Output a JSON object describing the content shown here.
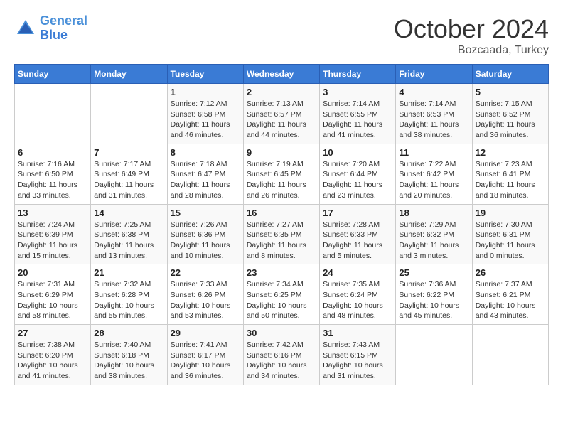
{
  "header": {
    "logo_line1": "General",
    "logo_line2": "Blue",
    "month": "October 2024",
    "location": "Bozcaada, Turkey"
  },
  "days_of_week": [
    "Sunday",
    "Monday",
    "Tuesday",
    "Wednesday",
    "Thursday",
    "Friday",
    "Saturday"
  ],
  "weeks": [
    [
      {
        "day": "",
        "info": ""
      },
      {
        "day": "",
        "info": ""
      },
      {
        "day": "1",
        "info": "Sunrise: 7:12 AM\nSunset: 6:58 PM\nDaylight: 11 hours and 46 minutes."
      },
      {
        "day": "2",
        "info": "Sunrise: 7:13 AM\nSunset: 6:57 PM\nDaylight: 11 hours and 44 minutes."
      },
      {
        "day": "3",
        "info": "Sunrise: 7:14 AM\nSunset: 6:55 PM\nDaylight: 11 hours and 41 minutes."
      },
      {
        "day": "4",
        "info": "Sunrise: 7:14 AM\nSunset: 6:53 PM\nDaylight: 11 hours and 38 minutes."
      },
      {
        "day": "5",
        "info": "Sunrise: 7:15 AM\nSunset: 6:52 PM\nDaylight: 11 hours and 36 minutes."
      }
    ],
    [
      {
        "day": "6",
        "info": "Sunrise: 7:16 AM\nSunset: 6:50 PM\nDaylight: 11 hours and 33 minutes."
      },
      {
        "day": "7",
        "info": "Sunrise: 7:17 AM\nSunset: 6:49 PM\nDaylight: 11 hours and 31 minutes."
      },
      {
        "day": "8",
        "info": "Sunrise: 7:18 AM\nSunset: 6:47 PM\nDaylight: 11 hours and 28 minutes."
      },
      {
        "day": "9",
        "info": "Sunrise: 7:19 AM\nSunset: 6:45 PM\nDaylight: 11 hours and 26 minutes."
      },
      {
        "day": "10",
        "info": "Sunrise: 7:20 AM\nSunset: 6:44 PM\nDaylight: 11 hours and 23 minutes."
      },
      {
        "day": "11",
        "info": "Sunrise: 7:22 AM\nSunset: 6:42 PM\nDaylight: 11 hours and 20 minutes."
      },
      {
        "day": "12",
        "info": "Sunrise: 7:23 AM\nSunset: 6:41 PM\nDaylight: 11 hours and 18 minutes."
      }
    ],
    [
      {
        "day": "13",
        "info": "Sunrise: 7:24 AM\nSunset: 6:39 PM\nDaylight: 11 hours and 15 minutes."
      },
      {
        "day": "14",
        "info": "Sunrise: 7:25 AM\nSunset: 6:38 PM\nDaylight: 11 hours and 13 minutes."
      },
      {
        "day": "15",
        "info": "Sunrise: 7:26 AM\nSunset: 6:36 PM\nDaylight: 11 hours and 10 minutes."
      },
      {
        "day": "16",
        "info": "Sunrise: 7:27 AM\nSunset: 6:35 PM\nDaylight: 11 hours and 8 minutes."
      },
      {
        "day": "17",
        "info": "Sunrise: 7:28 AM\nSunset: 6:33 PM\nDaylight: 11 hours and 5 minutes."
      },
      {
        "day": "18",
        "info": "Sunrise: 7:29 AM\nSunset: 6:32 PM\nDaylight: 11 hours and 3 minutes."
      },
      {
        "day": "19",
        "info": "Sunrise: 7:30 AM\nSunset: 6:31 PM\nDaylight: 11 hours and 0 minutes."
      }
    ],
    [
      {
        "day": "20",
        "info": "Sunrise: 7:31 AM\nSunset: 6:29 PM\nDaylight: 10 hours and 58 minutes."
      },
      {
        "day": "21",
        "info": "Sunrise: 7:32 AM\nSunset: 6:28 PM\nDaylight: 10 hours and 55 minutes."
      },
      {
        "day": "22",
        "info": "Sunrise: 7:33 AM\nSunset: 6:26 PM\nDaylight: 10 hours and 53 minutes."
      },
      {
        "day": "23",
        "info": "Sunrise: 7:34 AM\nSunset: 6:25 PM\nDaylight: 10 hours and 50 minutes."
      },
      {
        "day": "24",
        "info": "Sunrise: 7:35 AM\nSunset: 6:24 PM\nDaylight: 10 hours and 48 minutes."
      },
      {
        "day": "25",
        "info": "Sunrise: 7:36 AM\nSunset: 6:22 PM\nDaylight: 10 hours and 45 minutes."
      },
      {
        "day": "26",
        "info": "Sunrise: 7:37 AM\nSunset: 6:21 PM\nDaylight: 10 hours and 43 minutes."
      }
    ],
    [
      {
        "day": "27",
        "info": "Sunrise: 7:38 AM\nSunset: 6:20 PM\nDaylight: 10 hours and 41 minutes."
      },
      {
        "day": "28",
        "info": "Sunrise: 7:40 AM\nSunset: 6:18 PM\nDaylight: 10 hours and 38 minutes."
      },
      {
        "day": "29",
        "info": "Sunrise: 7:41 AM\nSunset: 6:17 PM\nDaylight: 10 hours and 36 minutes."
      },
      {
        "day": "30",
        "info": "Sunrise: 7:42 AM\nSunset: 6:16 PM\nDaylight: 10 hours and 34 minutes."
      },
      {
        "day": "31",
        "info": "Sunrise: 7:43 AM\nSunset: 6:15 PM\nDaylight: 10 hours and 31 minutes."
      },
      {
        "day": "",
        "info": ""
      },
      {
        "day": "",
        "info": ""
      }
    ]
  ]
}
